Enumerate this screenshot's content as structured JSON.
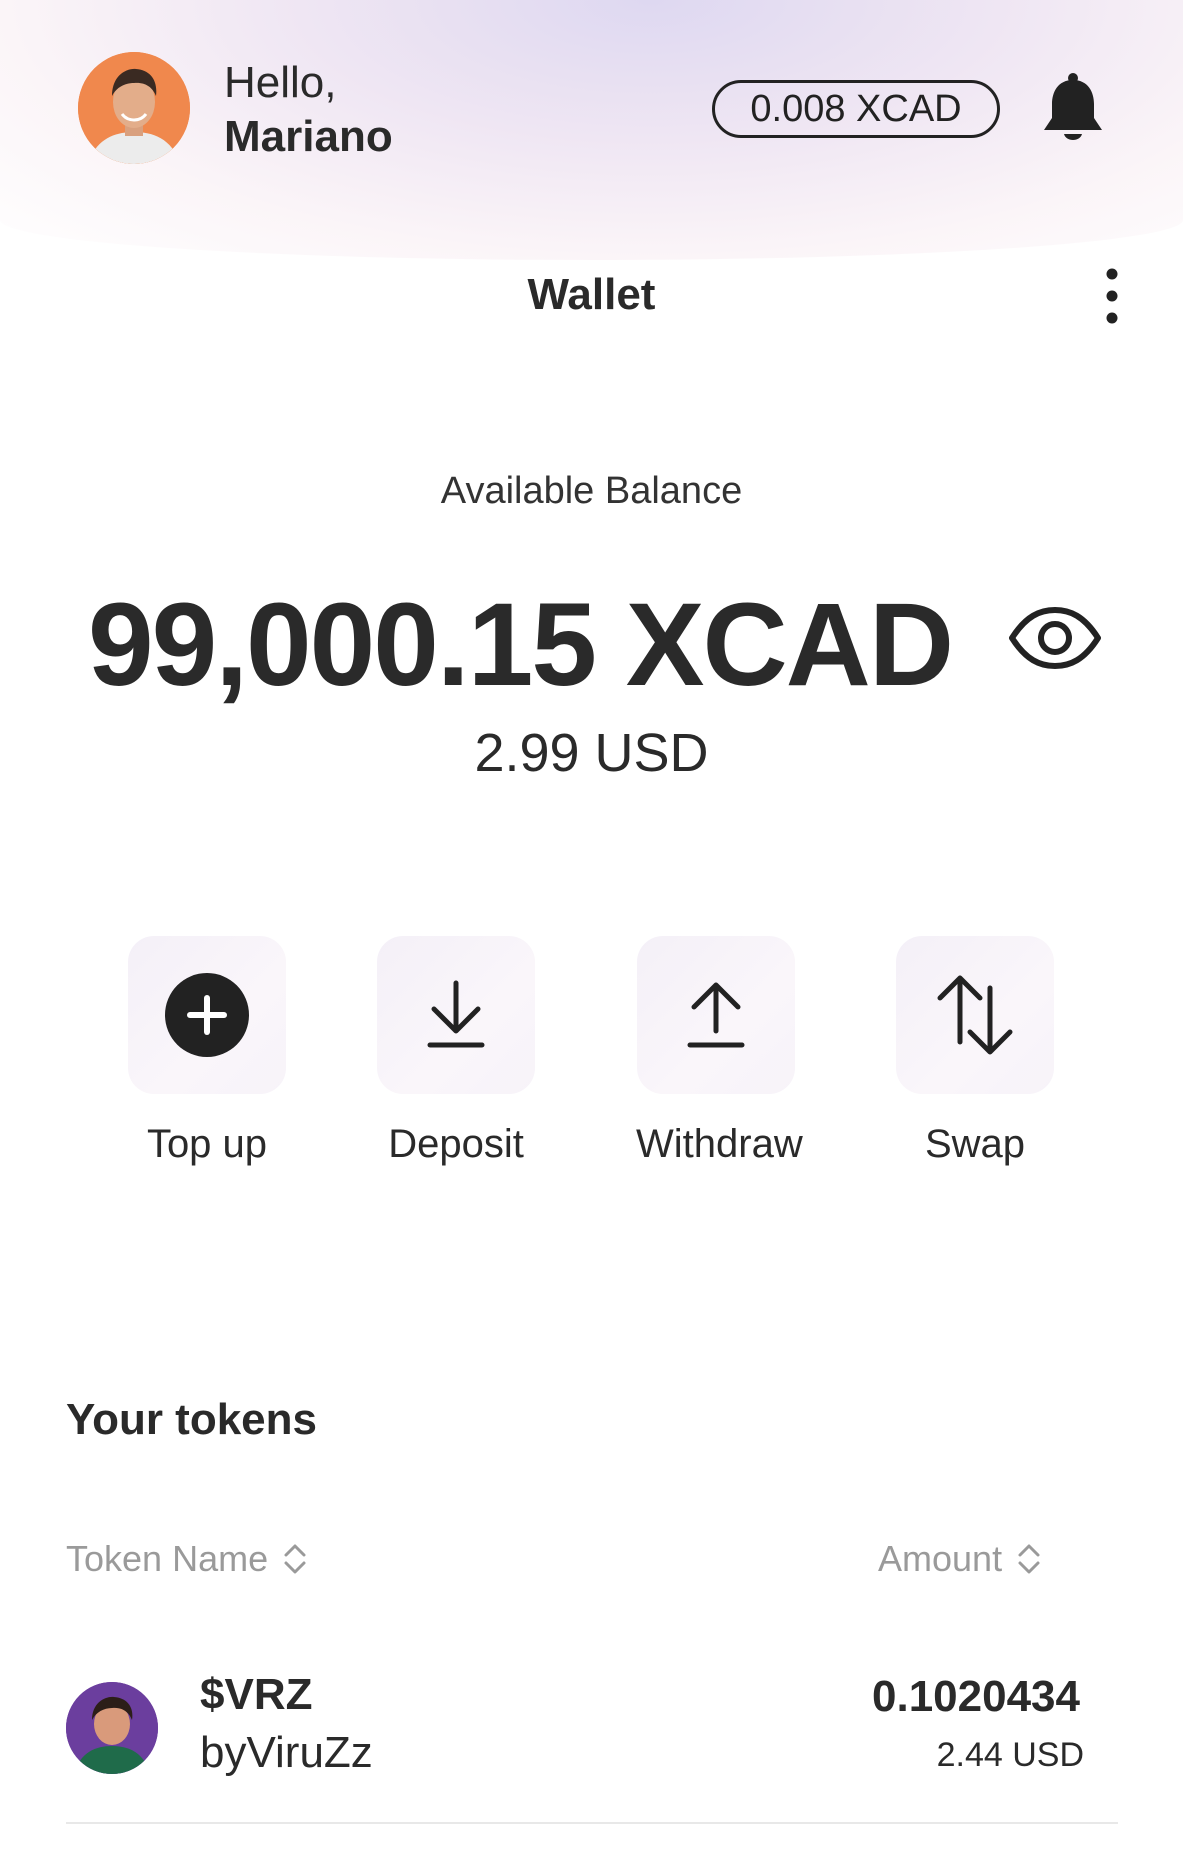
{
  "header": {
    "greeting": "Hello,",
    "user_name": "Mariano",
    "xcad_balance_pill": "0.008 XCAD"
  },
  "page": {
    "title": "Wallet"
  },
  "balance": {
    "label": "Available Balance",
    "amount": "99,000.15 XCAD",
    "usd": "2.99 USD"
  },
  "actions": [
    {
      "label": "Top up",
      "icon": "plus-circle-icon"
    },
    {
      "label": "Deposit",
      "icon": "download-icon"
    },
    {
      "label": "Withdraw",
      "icon": "upload-icon"
    },
    {
      "label": "Swap",
      "icon": "swap-arrows-icon"
    }
  ],
  "tokens": {
    "title": "Your tokens",
    "columns": {
      "name": "Token Name",
      "amount": "Amount"
    },
    "rows": [
      {
        "symbol": "$VRZ",
        "name": "byViruZz",
        "amount": "0.1020434",
        "usd": "2.44 USD"
      }
    ]
  },
  "colors": {
    "text": "#2a2a2a",
    "muted": "#9a9a9a",
    "avatar_bg": "#f0884d",
    "tile_bg": "#f4f0f8"
  }
}
